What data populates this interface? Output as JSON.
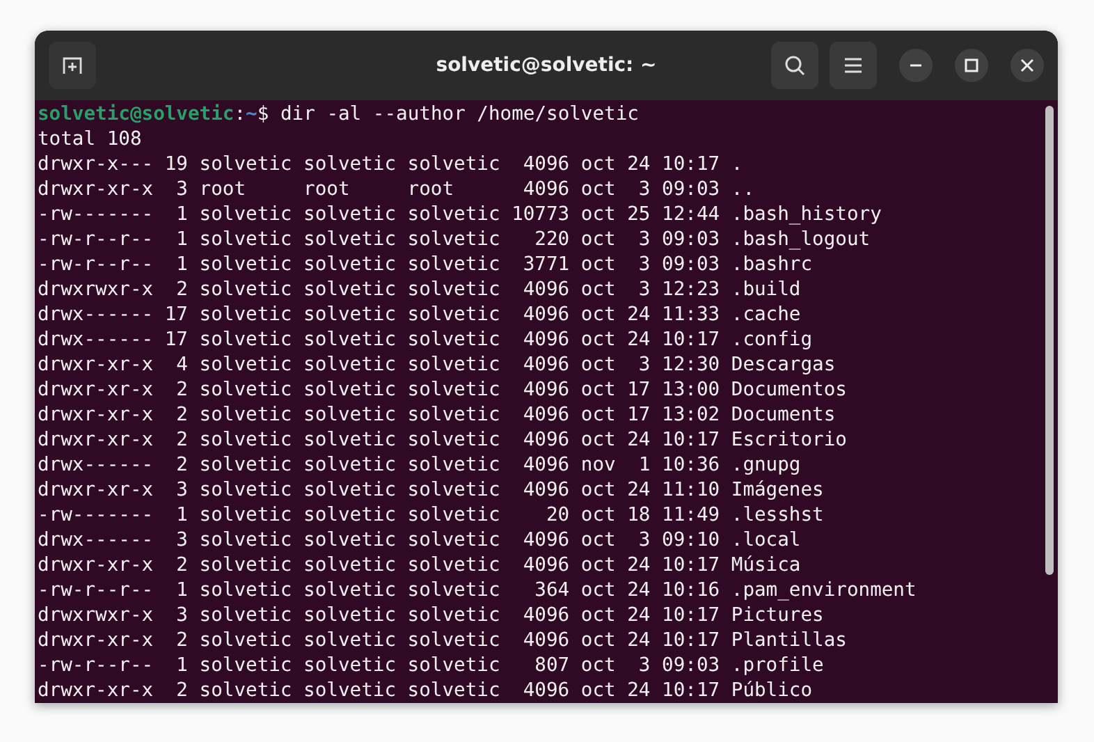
{
  "window": {
    "title": "solvetic@solvetic: ~"
  },
  "prompt": {
    "user_host": "solvetic@solvetic",
    "separator": ":",
    "path": "~",
    "symbol": "$",
    "command": "dir -al --author /home/solvetic"
  },
  "output": [
    "total 108",
    "drwxr-x--- 19 solvetic solvetic solvetic  4096 oct 24 10:17 .",
    "drwxr-xr-x  3 root     root     root      4096 oct  3 09:03 ..",
    "-rw-------  1 solvetic solvetic solvetic 10773 oct 25 12:44 .bash_history",
    "-rw-r--r--  1 solvetic solvetic solvetic   220 oct  3 09:03 .bash_logout",
    "-rw-r--r--  1 solvetic solvetic solvetic  3771 oct  3 09:03 .bashrc",
    "drwxrwxr-x  2 solvetic solvetic solvetic  4096 oct  3 12:23 .build",
    "drwx------ 17 solvetic solvetic solvetic  4096 oct 24 11:33 .cache",
    "drwx------ 17 solvetic solvetic solvetic  4096 oct 24 10:17 .config",
    "drwxr-xr-x  4 solvetic solvetic solvetic  4096 oct  3 12:30 Descargas",
    "drwxr-xr-x  2 solvetic solvetic solvetic  4096 oct 17 13:00 Documentos",
    "drwxr-xr-x  2 solvetic solvetic solvetic  4096 oct 17 13:02 Documents",
    "drwxr-xr-x  2 solvetic solvetic solvetic  4096 oct 24 10:17 Escritorio",
    "drwx------  2 solvetic solvetic solvetic  4096 nov  1 10:36 .gnupg",
    "drwxr-xr-x  3 solvetic solvetic solvetic  4096 oct 24 11:10 Imágenes",
    "-rw-------  1 solvetic solvetic solvetic    20 oct 18 11:49 .lesshst",
    "drwx------  3 solvetic solvetic solvetic  4096 oct  3 09:10 .local",
    "drwxr-xr-x  2 solvetic solvetic solvetic  4096 oct 24 10:17 Música",
    "-rw-r--r--  1 solvetic solvetic solvetic   364 oct 24 10:16 .pam_environment",
    "drwxrwxr-x  3 solvetic solvetic solvetic  4096 oct 24 10:17 Pictures",
    "drwxr-xr-x  2 solvetic solvetic solvetic  4096 oct 24 10:17 Plantillas",
    "-rw-r--r--  1 solvetic solvetic solvetic   807 oct  3 09:03 .profile",
    "drwxr-xr-x  2 solvetic solvetic solvetic  4096 oct 24 10:17 Público"
  ]
}
